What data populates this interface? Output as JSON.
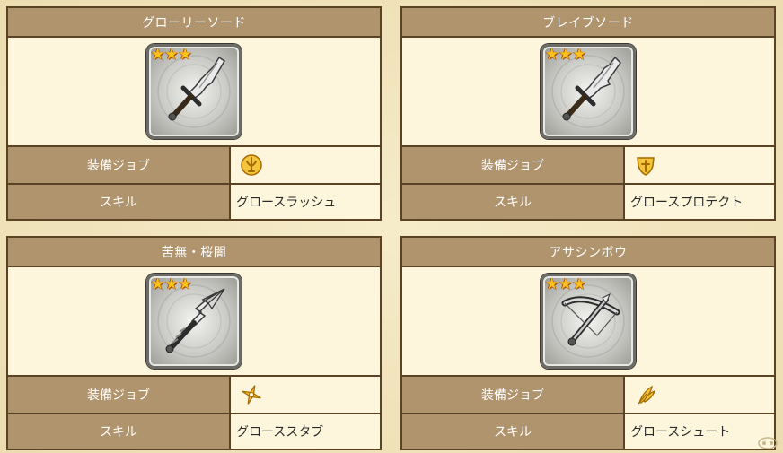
{
  "labels": {
    "job": "装備ジョブ",
    "skill": "スキル"
  },
  "rarity_star": "★",
  "cards": [
    {
      "title": "グローリーソード",
      "skill": "グロースラッシュ",
      "stars": 3,
      "weapon_icon": "sword-icon",
      "job_icon": "shield-crest-icon"
    },
    {
      "title": "ブレイブソード",
      "skill": "グロースプロテクト",
      "stars": 3,
      "weapon_icon": "sword-icon",
      "job_icon": "shield-icon"
    },
    {
      "title": "苦無・桜闇",
      "skill": "グローススタブ",
      "stars": 3,
      "weapon_icon": "kunai-icon",
      "job_icon": "shuriken-icon"
    },
    {
      "title": "アサシンボウ",
      "skill": "グロースシュート",
      "stars": 3,
      "weapon_icon": "crossbow-icon",
      "job_icon": "feather-icon"
    }
  ],
  "colors": {
    "header_bg": "#b0946e",
    "border": "#5a4224",
    "cell_bg": "#fdf6dc",
    "page_bg": "#f0e3bd",
    "star": "#ffc21a",
    "job_icon": "#e0a000"
  }
}
